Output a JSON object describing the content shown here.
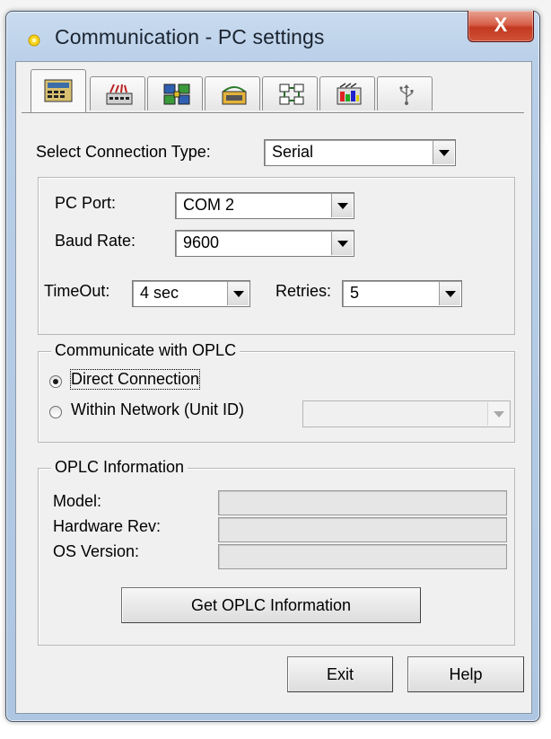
{
  "window": {
    "title": "Communication - PC settings",
    "close_label": "X"
  },
  "tabs": [
    {
      "icon": "memory-icon",
      "active": true
    },
    {
      "icon": "io-module-icon",
      "active": false
    },
    {
      "icon": "network-grid-icon",
      "active": false
    },
    {
      "icon": "modem-icon",
      "active": false
    },
    {
      "icon": "network-nodes-icon",
      "active": false
    },
    {
      "icon": "data-color-icon",
      "active": false
    },
    {
      "icon": "usb-icon",
      "active": false
    }
  ],
  "connection": {
    "label": "Select Connection Type:",
    "value": "Serial"
  },
  "serial": {
    "port_label": "PC Port:",
    "port_value": "COM 2",
    "baud_label": "Baud Rate:",
    "baud_value": "9600",
    "timeout_label": "TimeOut:",
    "timeout_value": "4 sec",
    "retries_label": "Retries:",
    "retries_value": "5"
  },
  "communicate": {
    "legend": "Communicate with OPLC",
    "direct_label": "Direct Connection",
    "network_label": "Within Network (Unit ID)",
    "selected": "direct",
    "unit_id_value": ""
  },
  "info": {
    "legend": "OPLC Information",
    "model_label": "Model:",
    "model_value": "",
    "hw_label": "Hardware Rev:",
    "hw_value": "",
    "os_label": "OS Version:",
    "os_value": "",
    "get_button": "Get OPLC Information"
  },
  "footer": {
    "exit_button": "Exit",
    "help_button": "Help"
  }
}
